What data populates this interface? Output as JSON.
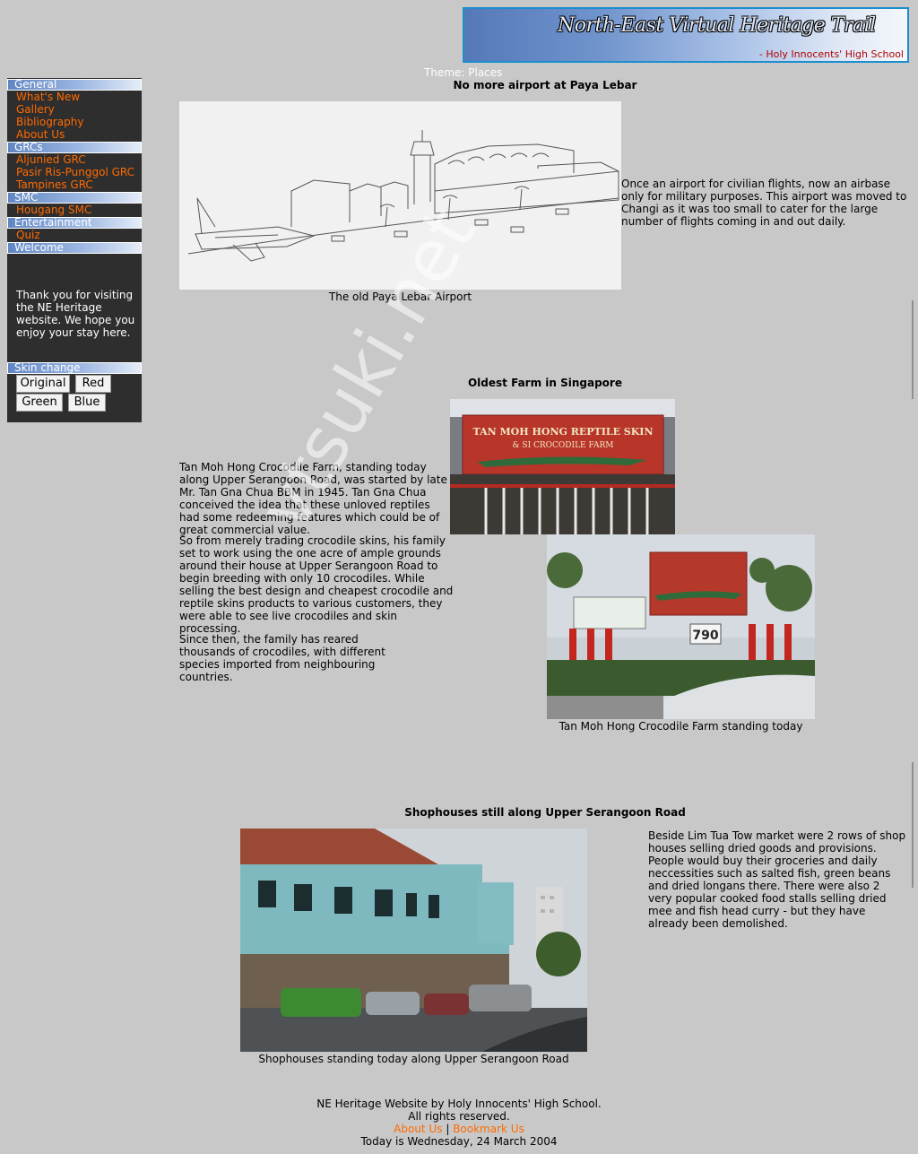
{
  "banner": {
    "title": "North-East Virtual Heritage Trail",
    "school": "- Holy Innocents' High School"
  },
  "sidebar": {
    "sections": [
      {
        "title": "General",
        "items": [
          "What's New",
          "Gallery",
          "Bibliography",
          "About Us"
        ]
      },
      {
        "title": "GRCs",
        "items": [
          "Aljunied GRC",
          "Pasir Ris-Punggol GRC",
          "Tampines GRC"
        ]
      },
      {
        "title": "SMC",
        "items": [
          "Hougang SMC"
        ]
      },
      {
        "title": "Entertainment",
        "items": [
          "Quiz"
        ]
      },
      {
        "title": "Welcome",
        "text": "Thank you for visiting the NE Heritage website. We hope you enjoy your stay here."
      },
      {
        "title": "Skin change",
        "buttons": [
          "Original",
          "Red",
          "Green",
          "Blue"
        ]
      }
    ]
  },
  "content": {
    "theme": "Theme: Places",
    "airport": {
      "heading": "No more airport at Paya Lebar",
      "caption": "The old Paya Lebar Airport",
      "text": "Once an airport for civilian flights, now an airbase only for military purposes. This airport was moved to Changi as it was too small to cater for the large number of flights coming in and out daily."
    },
    "farm": {
      "heading": "Oldest Farm in Singapore",
      "paragraphs": [
        "Tan Moh Hong Crocodile Farm, standing today along Upper Serangoon Road, was started by late Mr. Tan Gna Chua BBM in 1945. Tan Gna Chua conceived the idea that these unloved reptiles had some redeeming features which could be of great commercial value.",
        "So from merely trading crocodile skins, his family set to work using the one acre of ample grounds around their house at Upper Serangoon Road to begin breeding with only 10 crocodiles. While selling the best design and cheapest crocodile and reptile skins products to various customers, they were able to see live crocodiles and skin processing.",
        "Since then, the family has reared thousands of crocodiles, with different species imported from neighbouring countries."
      ],
      "sign_text": "TAN MOH HONG REPTILE SKIN",
      "sign_sub": "& SI CROCODILE FARM",
      "number": "790",
      "caption": "Tan Moh Hong Crocodile Farm standing today"
    },
    "shophouses": {
      "heading": "Shophouses still along Upper Serangoon Road",
      "text": "Beside Lim Tua Tow market were 2 rows of shop houses selling dried goods and provisions. People would buy their groceries and daily neccessities such as salted fish, green beans and dried longans there. There were also 2 very popular cooked food stalls selling dried mee and fish head curry - but they have already been demolished.",
      "caption": "Shophouses standing today along Upper Serangoon Road"
    }
  },
  "footer": {
    "line1": "NE Heritage Website by Holy Innocents' High School.",
    "line2": "All rights reserved.",
    "about": "About Us",
    "sep": "|",
    "bookmark": "Bookmark Us",
    "date": "Today is Wednesday, 24 March 2004"
  },
  "watermark": "vtsuki.net",
  "colors": {
    "background": "#c8c8c8",
    "sidebar": "#2e2e2e",
    "link": "#ff6a00",
    "banner_border": "#1c8ed0"
  }
}
